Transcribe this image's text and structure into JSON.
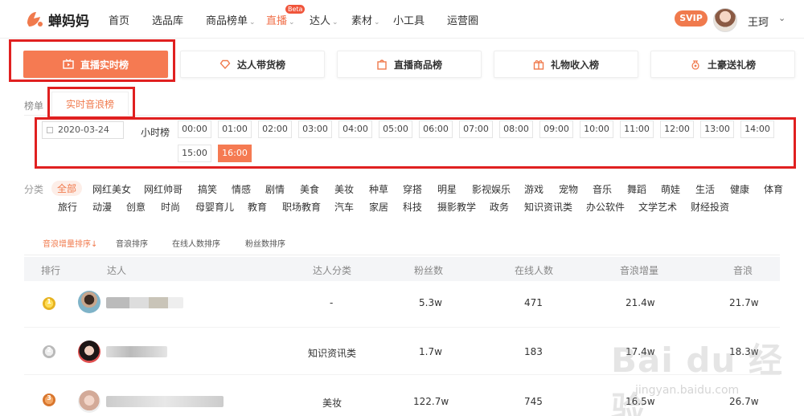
{
  "brand": {
    "name": "蝉妈妈",
    "logo_color": "#f07a4d"
  },
  "nav": [
    {
      "label": "首页",
      "active": false,
      "caret": false
    },
    {
      "label": "选品库",
      "active": false,
      "caret": false
    },
    {
      "label": "商品榜单",
      "active": false,
      "caret": true
    },
    {
      "label": "直播",
      "active": true,
      "caret": true
    },
    {
      "label": "达人",
      "active": false,
      "caret": true
    },
    {
      "label": "素材",
      "active": false,
      "caret": true
    },
    {
      "label": "小工具",
      "active": false,
      "caret": false
    },
    {
      "label": "运营圈",
      "active": false,
      "caret": false
    }
  ],
  "nav_badge": "Beta",
  "user": {
    "vip_badge": "SVIP",
    "name": "王珂"
  },
  "boards": [
    {
      "label": "直播实时榜",
      "active": true,
      "icon": "play-screen-icon"
    },
    {
      "label": "达人带货榜",
      "active": false,
      "icon": "heart-diamond-icon"
    },
    {
      "label": "直播商品榜",
      "active": false,
      "icon": "shopping-bag-icon"
    },
    {
      "label": "礼物收入榜",
      "active": false,
      "icon": "gift-icon"
    },
    {
      "label": "土豪送礼榜",
      "active": false,
      "icon": "money-bag-icon"
    }
  ],
  "sub_list": {
    "label": "榜单",
    "tab": "实时音浪榜"
  },
  "time_filter": {
    "date": "2020-03-24",
    "hour_label": "小时榜",
    "hours": [
      "00:00",
      "01:00",
      "02:00",
      "03:00",
      "04:00",
      "05:00",
      "06:00",
      "07:00",
      "08:00",
      "09:00",
      "10:00",
      "11:00",
      "12:00",
      "13:00",
      "14:00",
      "15:00",
      "16:00"
    ],
    "active_hour": "16:00"
  },
  "categories": {
    "label": "分类",
    "active": "全部",
    "items": [
      "全部",
      "网红美女",
      "网红帅哥",
      "搞笑",
      "情感",
      "剧情",
      "美食",
      "美妆",
      "种草",
      "穿搭",
      "明星",
      "影视娱乐",
      "游戏",
      "宠物",
      "音乐",
      "舞蹈",
      "萌娃",
      "生活",
      "健康",
      "体育",
      "旅行",
      "动漫",
      "创意",
      "时尚",
      "母婴育儿",
      "教育",
      "职场教育",
      "汽车",
      "家居",
      "科技",
      "摄影教学",
      "政务",
      "知识资讯类",
      "办公软件",
      "文学艺术",
      "财经投资"
    ]
  },
  "sort_tabs": [
    {
      "label": "音浪增量排序",
      "active": true
    },
    {
      "label": "音浪排序",
      "active": false
    },
    {
      "label": "在线人数排序",
      "active": false
    },
    {
      "label": "粉丝数排序",
      "active": false
    }
  ],
  "table": {
    "columns": [
      "排行",
      "达人",
      "达人分类",
      "粉丝数",
      "在线人数",
      "音浪增量",
      "音浪"
    ],
    "rows": [
      {
        "rank": "1",
        "medal": "gold",
        "category": "-",
        "fans": "5.3w",
        "online": "471",
        "increase": "21.4w",
        "total": "21.7w"
      },
      {
        "rank": "2",
        "medal": "silver",
        "category": "知识资讯类",
        "fans": "1.7w",
        "online": "183",
        "increase": "17.4w",
        "total": "18.3w"
      },
      {
        "rank": "3",
        "medal": "bronze",
        "category": "美妆",
        "fans": "122.7w",
        "online": "745",
        "increase": "16.5w",
        "total": "26.7w"
      }
    ]
  },
  "watermark": {
    "main": "Bai du 经验",
    "sub": "jingyan.baidu.com"
  },
  "accent": "#f57a52",
  "highlight_color": "#e02020"
}
